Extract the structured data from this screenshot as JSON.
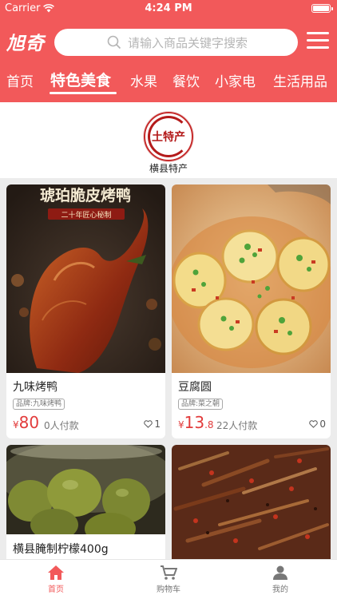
{
  "status_bar": {
    "carrier": "Carrier",
    "time": "4:24 PM"
  },
  "header": {
    "logo": "旭奇",
    "search_placeholder": "请输入商品关键字搜索",
    "bg_color": "#f2595a"
  },
  "tabs": [
    {
      "label": "首页",
      "active": false
    },
    {
      "label": "特色美食",
      "active": true
    },
    {
      "label": "水果",
      "active": false
    },
    {
      "label": "餐饮",
      "active": false
    },
    {
      "label": "小家电",
      "active": false
    },
    {
      "label": "生活用品",
      "active": false
    }
  ],
  "brand": {
    "logo_text": "土特产",
    "name": "横县特产"
  },
  "products": [
    {
      "image_title": "琥珀脆皮烤鸭",
      "image_subtitle": "二十年匠心秘制",
      "name": "九味烤鸭",
      "brand_tag": "品牌:九味烤鸭",
      "currency": "¥",
      "price_int": "80",
      "price_dec": "",
      "sold": "0人付款",
      "likes": "1"
    },
    {
      "name": "豆腐圆",
      "brand_tag": "品牌:菜之朝",
      "currency": "¥",
      "price_int": "13",
      "price_dec": ".8",
      "sold": "22人付款",
      "likes": "0"
    },
    {
      "name": "横县腌制柠檬400g"
    },
    {
      "name": ""
    }
  ],
  "tabbar": [
    {
      "label": "首页",
      "icon": "home-icon",
      "active": true
    },
    {
      "label": "购物车",
      "icon": "cart-icon",
      "active": false
    },
    {
      "label": "我的",
      "icon": "user-icon",
      "active": false
    }
  ],
  "colors": {
    "accent": "#f2595a",
    "price": "#e23b3b"
  }
}
